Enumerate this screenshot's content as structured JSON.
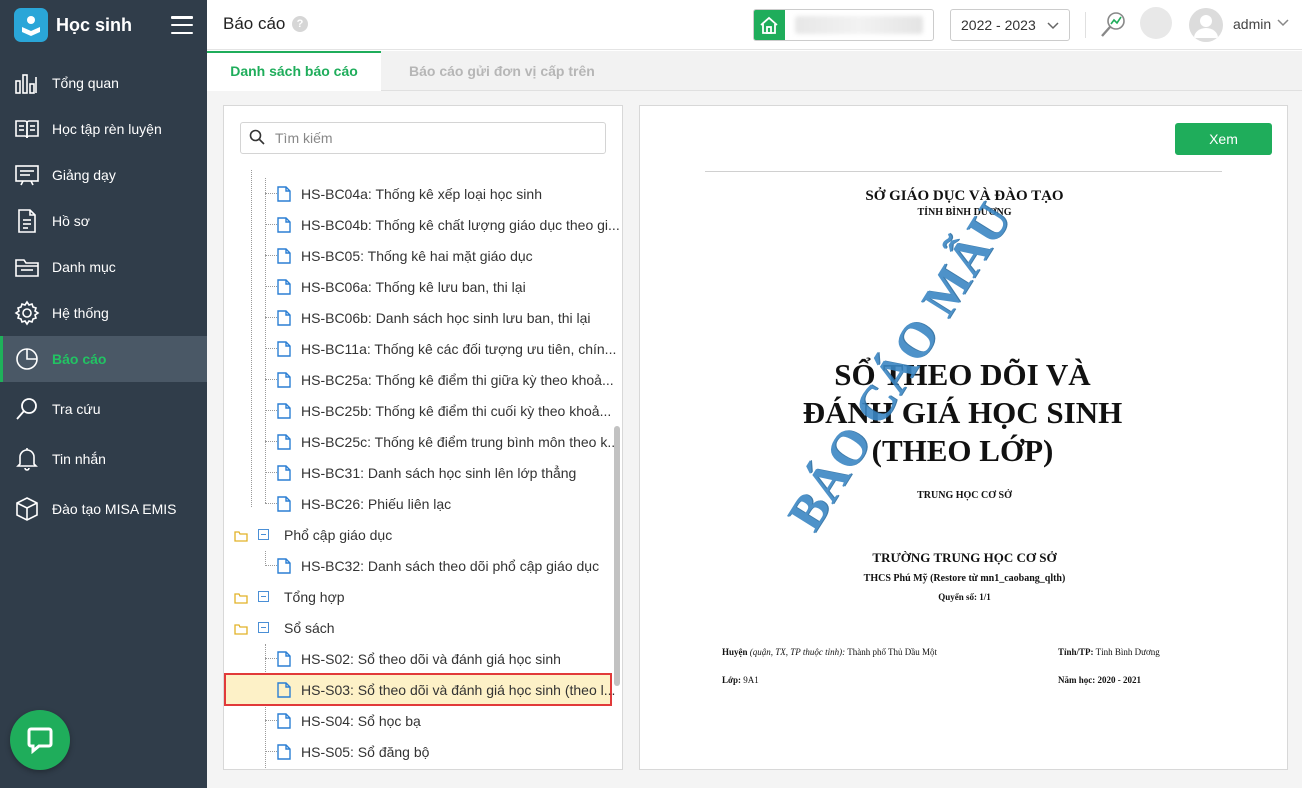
{
  "app": {
    "title": "Học sinh"
  },
  "sidebar": {
    "items": [
      {
        "label": "Tổng quan",
        "icon": "bar-chart-icon"
      },
      {
        "label": "Học tập rèn luyện",
        "icon": "book-icon"
      },
      {
        "label": "Giảng dạy",
        "icon": "blackboard-icon"
      },
      {
        "label": "Hồ sơ",
        "icon": "document-icon"
      },
      {
        "label": "Danh mục",
        "icon": "folder-icon"
      },
      {
        "label": "Hệ thống",
        "icon": "gear-icon"
      },
      {
        "label": "Báo cáo",
        "icon": "pie-chart-icon",
        "active": true
      },
      {
        "label": "Tra cứu",
        "icon": "search-icon"
      },
      {
        "label": "Tin nhắn",
        "icon": "bell-icon"
      },
      {
        "label": "Đào tạo MISA EMIS",
        "icon": "cube-icon"
      }
    ]
  },
  "header": {
    "page_title": "Báo cáo",
    "help": "?",
    "school_year": "2022 - 2023",
    "user": "admin"
  },
  "tabs": [
    {
      "label": "Danh sách báo cáo",
      "active": true
    },
    {
      "label": "Báo cáo gửi đơn vị cấp trên",
      "active": false
    }
  ],
  "search": {
    "placeholder": "Tìm kiếm"
  },
  "tree": {
    "items": [
      {
        "label": "HS-BC04a: Thống kê xếp loại học sinh"
      },
      {
        "label": "HS-BC04b: Thống kê chất lượng giáo dục theo gi..."
      },
      {
        "label": "HS-BC05: Thống kê hai mặt giáo dục"
      },
      {
        "label": "HS-BC06a: Thống kê lưu ban, thi lại"
      },
      {
        "label": "HS-BC06b: Danh sách học sinh lưu ban, thi lại"
      },
      {
        "label": "HS-BC11a: Thống kê các đối tượng ưu tiên, chín..."
      },
      {
        "label": "HS-BC25a: Thống kê điểm thi giữa kỳ theo khoả..."
      },
      {
        "label": "HS-BC25b: Thống kê điểm thi cuối kỳ theo khoả..."
      },
      {
        "label": "HS-BC25c: Thống kê điểm trung bình môn theo k..."
      },
      {
        "label": "HS-BC31: Danh sách học sinh lên lớp thẳng"
      },
      {
        "label": "HS-BC26: Phiếu liên lạc"
      }
    ],
    "groups": [
      {
        "label": "Phổ cập giáo dục",
        "items": [
          {
            "label": "HS-BC32: Danh sách theo dõi phổ cập giáo dục"
          }
        ]
      },
      {
        "label": "Tổng hợp",
        "items": []
      },
      {
        "label": "Sổ sách",
        "items": [
          {
            "label": "HS-S02: Sổ theo dõi và đánh giá học sinh"
          },
          {
            "label": "HS-S03: Sổ theo dõi và đánh giá học sinh (theo l...",
            "selected": true
          },
          {
            "label": "HS-S04: Sổ học bạ"
          },
          {
            "label": "HS-S05: Sổ đăng bộ"
          }
        ]
      }
    ]
  },
  "preview": {
    "button_label": "Xem",
    "department": "SỞ GIÁO DỤC VÀ ĐÀO TẠO",
    "province": "TỈNH BÌNH DƯƠNG",
    "title_line1": "SỔ THEO DÕI VÀ",
    "title_line2": "ĐÁNH GIÁ HỌC SINH",
    "title_line3": "(THEO LỚP)",
    "level": "TRUNG HỌC CƠ SỞ",
    "school_type": "TRƯỜNG TRUNG HỌC CƠ SỞ",
    "school_name": "THCS Phú Mỹ  (Restore từ mn1_caobang_qlth)",
    "volume": "Quyển số: 1/1",
    "district_label": "Huyện",
    "district_note": "(quận, TX, TP thuộc tỉnh):",
    "district_value": "Thành phố Thủ Dầu Một",
    "province_label": "Tỉnh/TP:",
    "province_value": "Tỉnh Bình Dương",
    "class_label": "Lớp:",
    "class_value": "9A1",
    "year_label": "Năm học:",
    "year_value": "2020 - 2021",
    "watermark": "BÁO CÁO MẪU"
  },
  "colors": {
    "accent": "#1fad5b",
    "sidebar_bg": "#303d4a",
    "selection_border": "#e13a3a",
    "watermark": "#3b87c4"
  }
}
